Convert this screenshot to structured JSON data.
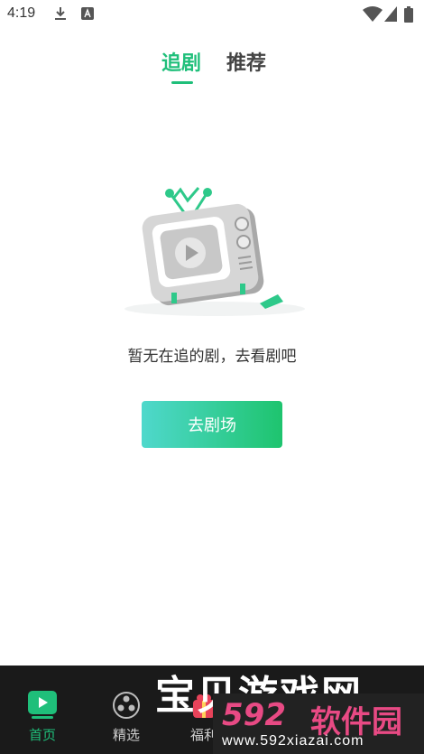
{
  "status_bar": {
    "time": "4:19",
    "icons": [
      "download-icon",
      "a-notification-icon",
      "wifi-icon",
      "signal-icon",
      "battery-icon"
    ]
  },
  "tabs": [
    {
      "label": "追剧",
      "active": true
    },
    {
      "label": "推荐",
      "active": false
    }
  ],
  "empty_state": {
    "illustration": "tv-icon",
    "message": "暂无在追的剧，去看剧吧",
    "button_label": "去剧场"
  },
  "bottom_nav": {
    "items": [
      {
        "label": "首页",
        "icon": "home-play-icon",
        "active": true
      },
      {
        "label": "精选",
        "icon": "film-reel-icon",
        "active": false
      },
      {
        "label": "福利",
        "icon": "gift-icon",
        "active": false
      }
    ]
  },
  "watermark": {
    "title": "宝贝游戏网",
    "number": "592",
    "site_name": "软件园",
    "url": "www.592xiazai.com"
  },
  "colors": {
    "accent": "#1fbf7a",
    "button_gradient_start": "#4fd8cc",
    "button_gradient_end": "#1ec46e",
    "nav_background": "#1a1a1a",
    "watermark_pink": "#e84a84"
  }
}
